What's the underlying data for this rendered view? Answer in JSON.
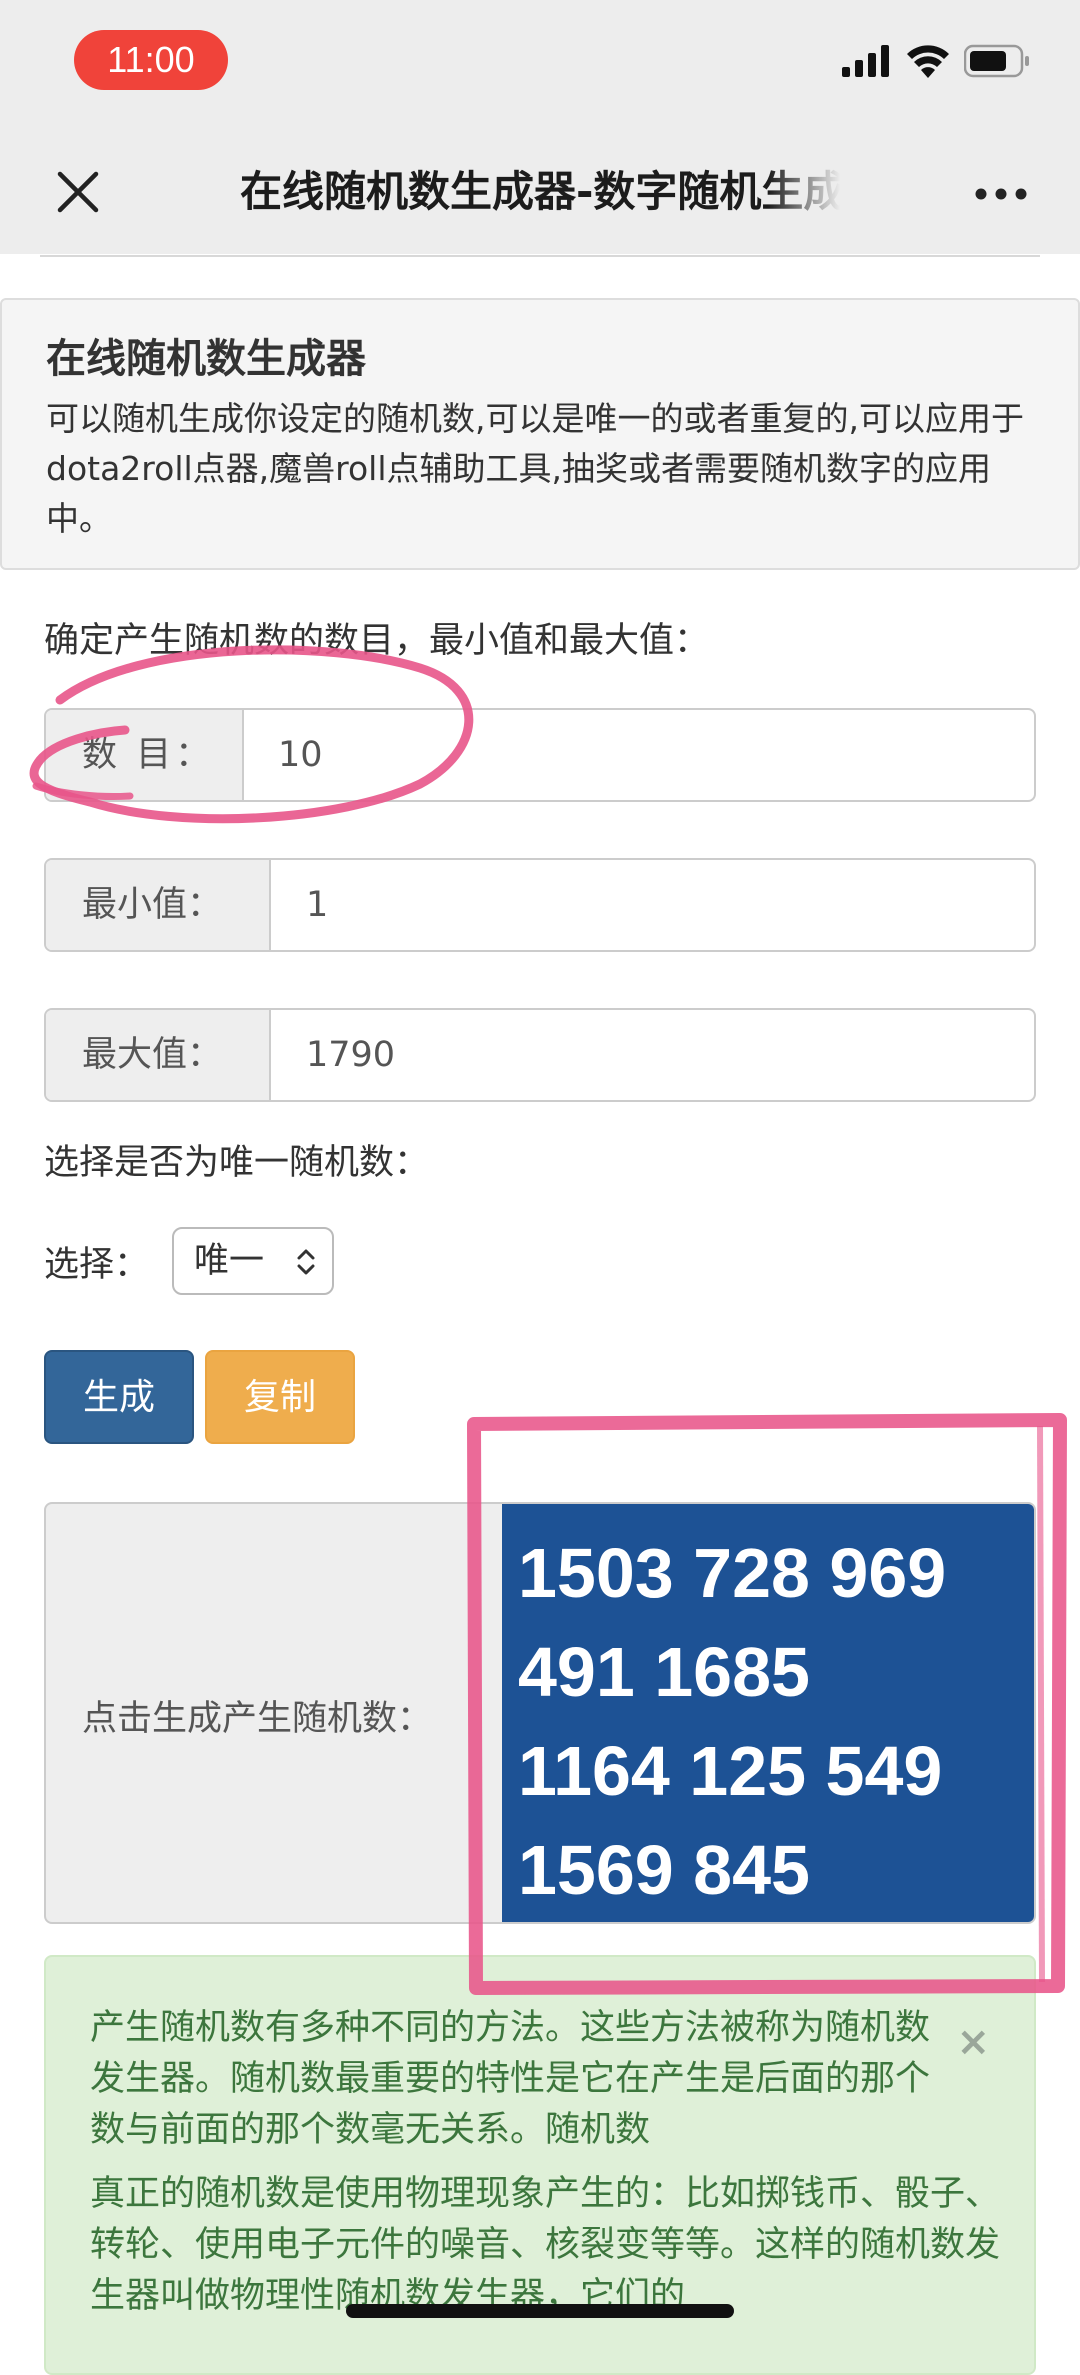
{
  "status_bar": {
    "time": "11:00",
    "icons": [
      "signal-icon",
      "wifi-icon",
      "battery-icon"
    ]
  },
  "nav": {
    "close_icon": "close-icon",
    "title": "在线随机数生成器-数字随机生成器",
    "more_icon": "more-icon"
  },
  "panel": {
    "title": "在线随机数生成器",
    "description": "可以随机生成你设定的随机数,可以是唯一的或者重复的,可以应用于dota2roll点器,魔兽roll点辅助工具,抽奖或者需要随机数字的应用中。"
  },
  "form": {
    "prompt": "确定产生随机数的数目，最小值和最大值：",
    "count_label": "数 目：",
    "count_value": "10",
    "min_label": "最小值：",
    "min_value": "1",
    "max_label": "最大值：",
    "max_value": "1790",
    "unique_prompt": "选择是否为唯一随机数：",
    "select_label": "选择：",
    "select_value": "唯一"
  },
  "buttons": {
    "generate": "生成",
    "copy": "复制"
  },
  "result": {
    "label": "点击生成产生随机数：",
    "lines": [
      "1503 728 969",
      "491 1685",
      "1164 125 549",
      "1569 845"
    ]
  },
  "alert": {
    "p1": "产生随机数有多种不同的方法。这些方法被称为随机数发生器。随机数最重要的特性是它在产生是后面的那个数与前面的那个数毫无关系。随机数",
    "p2": "真正的随机数是使用物理现象产生的：比如掷钱币、骰子、转轮、使用电子元件的噪音、核裂变等等。这样的随机数发生器叫做物理性随机数发生器，它们的",
    "close": "×"
  },
  "colors": {
    "status_pill": "#f0433a",
    "generate_button": "#336699",
    "copy_button": "#efad4d",
    "result_box": "#1d5295",
    "alert_bg": "#dff0d8",
    "annotation": "#e8558a"
  }
}
